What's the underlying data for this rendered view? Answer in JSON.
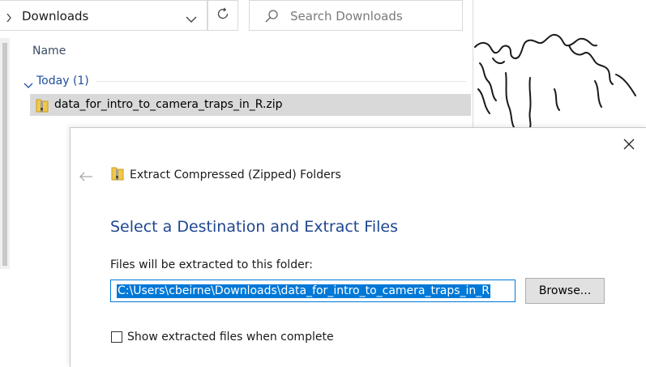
{
  "explorer": {
    "address": "Downloads",
    "search_placeholder": "Search Downloads",
    "column_name": "Name",
    "group_label": "Today (1)",
    "file_name": "data_for_intro_to_camera_traps_in_R.zip"
  },
  "dialog": {
    "wizard_title": "Extract Compressed (Zipped) Folders",
    "heading": "Select a Destination and Extract Files",
    "destination_label": "Files will be extracted to this folder:",
    "destination_value": "C:\\Users\\cbeirne\\Downloads\\data_for_intro_to_camera_traps_in_R",
    "browse_label": "Browse...",
    "show_files_label": "Show extracted files when complete",
    "show_files_checked": false
  },
  "icons": {
    "chevron_right": "chevron-right-icon",
    "chevron_down": "chevron-down-icon",
    "refresh": "refresh-icon",
    "search": "search-icon",
    "zip": "zip-folder-icon",
    "close": "close-icon",
    "back": "back-arrow-icon"
  },
  "colors": {
    "accent": "#0078d7",
    "heading": "#1f4690",
    "selection_row": "#d9d9d9",
    "button_face": "#e1e1e1"
  }
}
